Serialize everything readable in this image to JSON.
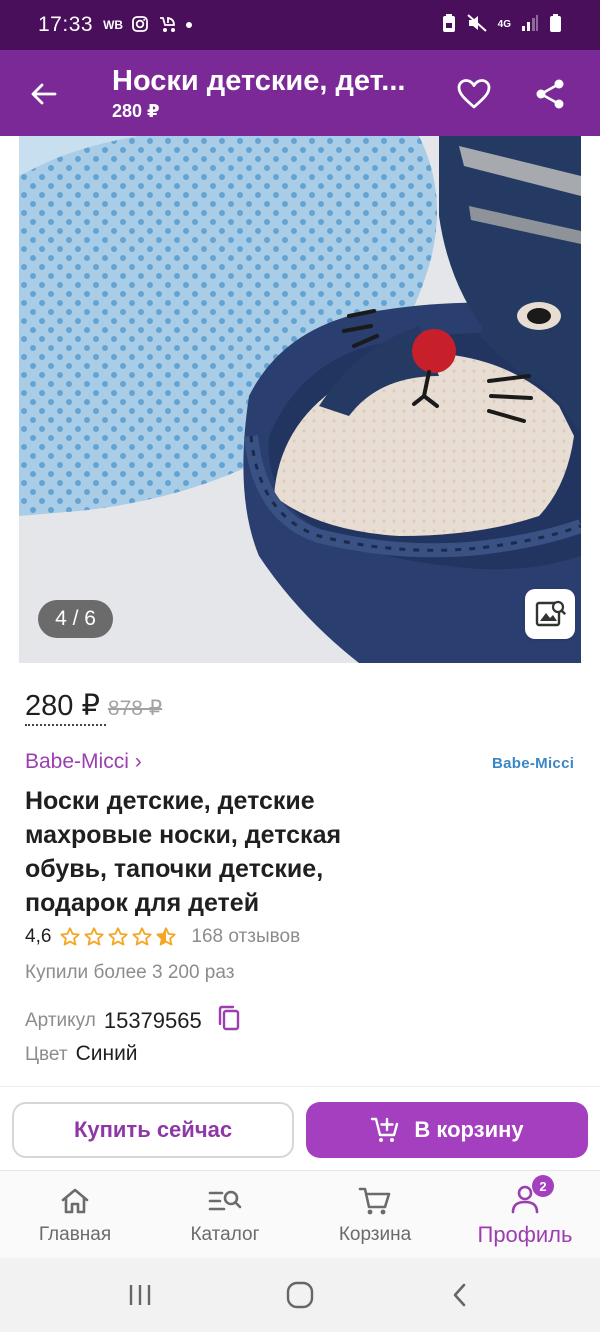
{
  "status_bar": {
    "time": "17:33",
    "left_icons": [
      "wb-icon",
      "instagram-icon",
      "stroller-icon",
      "dot-icon"
    ],
    "right_icons": [
      "lock-battery-icon",
      "mute-icon",
      "network-4g-icon",
      "signal-icon",
      "battery-icon"
    ],
    "network_label": "4G"
  },
  "app_bar": {
    "title": "Носки детские, дет...",
    "subtitle": "280 ₽",
    "back_icon": "arrow-left-icon",
    "favorite_icon": "heart-icon",
    "share_icon": "share-icon"
  },
  "gallery": {
    "counter": "4 / 6",
    "search_icon": "image-search-icon"
  },
  "price": {
    "current": "280 ₽",
    "old": "878 ₽"
  },
  "brand": {
    "name": "Babe-Micci ›",
    "logo_text": "Babe-Micci"
  },
  "product": {
    "title": "Носки детские, детские махровые носки, детская обувь, тапочки детские, подарок для детей",
    "rating": "4,6",
    "stars": 4.5,
    "reviews": "168 отзывов",
    "bought": "Купили более 3 200 раз",
    "article_label": "Артикул",
    "article_value": "15379565",
    "color_label": "Цвет",
    "color_value": "Синий"
  },
  "actions": {
    "buy_now": "Купить сейчас",
    "add_to_cart": "В корзину"
  },
  "bottom_nav": {
    "items": [
      {
        "label": "Главная",
        "icon": "home-icon"
      },
      {
        "label": "Каталог",
        "icon": "catalog-search-icon"
      },
      {
        "label": "Корзина",
        "icon": "cart-icon"
      },
      {
        "label": "Профиль",
        "icon": "profile-icon",
        "badge": "2"
      }
    ],
    "active_index": 3
  },
  "colors": {
    "status_bar": "#4a0f5a",
    "app_bar": "#7a2996",
    "accent": "#a43fbf",
    "brand_link": "#9b3fb0",
    "star": "#f5a623"
  }
}
